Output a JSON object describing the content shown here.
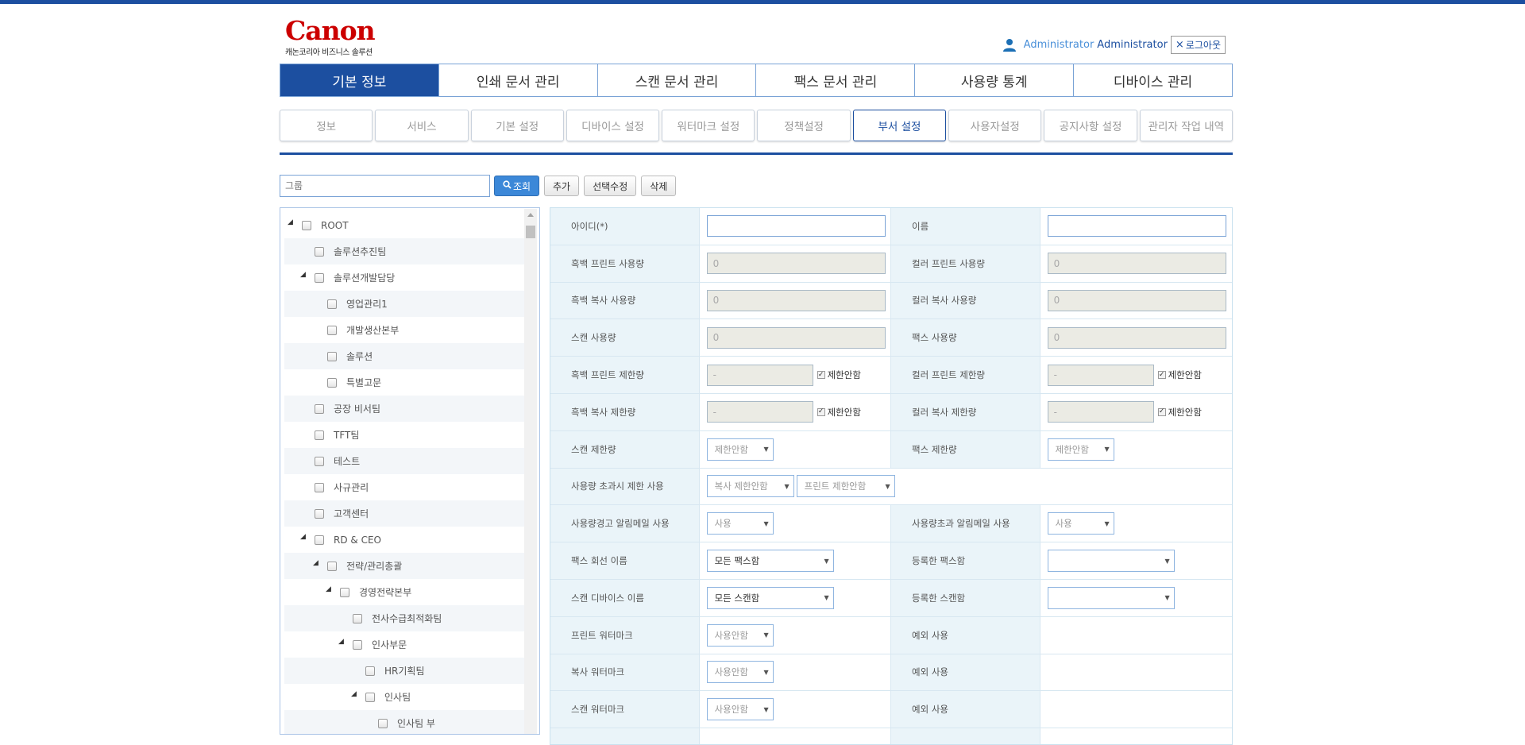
{
  "header": {
    "brand": "Canon",
    "brand_sub": "캐논코리아 비즈니스 솔루션",
    "user_role": "Administrator",
    "user_name": "Administrator",
    "logout_label": "로그아웃"
  },
  "main_nav": [
    {
      "label": "기본 정보",
      "active": true
    },
    {
      "label": "인쇄 문서 관리"
    },
    {
      "label": "스캔 문서 관리"
    },
    {
      "label": "팩스 문서 관리"
    },
    {
      "label": "사용량 통계"
    },
    {
      "label": "디바이스 관리"
    }
  ],
  "sub_nav": [
    {
      "label": "정보"
    },
    {
      "label": "서비스"
    },
    {
      "label": "기본 설정"
    },
    {
      "label": "디바이스 설정"
    },
    {
      "label": "워터마크 설정"
    },
    {
      "label": "정책설정"
    },
    {
      "label": "부서 설정",
      "active": true
    },
    {
      "label": "사용자설정"
    },
    {
      "label": "공지사항 설정"
    },
    {
      "label": "관리자 작업 내역"
    }
  ],
  "toolbar": {
    "search_placeholder": "그룹",
    "search_label": "조회",
    "add_label": "추가",
    "edit_label": "선택수정",
    "delete_label": "삭제"
  },
  "tree": [
    {
      "label": "ROOT",
      "level": 0,
      "expanded": true
    },
    {
      "label": "솔루션추진팀",
      "level": 1
    },
    {
      "label": "솔루션개발담당",
      "level": 1,
      "expanded": true
    },
    {
      "label": "영업관리1",
      "level": 2
    },
    {
      "label": "개발생산본부",
      "level": 2
    },
    {
      "label": "솔루션",
      "level": 2
    },
    {
      "label": "특별고문",
      "level": 2
    },
    {
      "label": "공장 비서팀",
      "level": 1
    },
    {
      "label": "TFT팀",
      "level": 1
    },
    {
      "label": "테스트",
      "level": 1
    },
    {
      "label": "사규관리",
      "level": 1
    },
    {
      "label": "고객센터",
      "level": 1
    },
    {
      "label": "RD & CEO",
      "level": 1,
      "expanded": true
    },
    {
      "label": "전략/관리총괄",
      "level": 2,
      "expanded": true
    },
    {
      "label": "경영전략본부",
      "level": 3,
      "expanded": true
    },
    {
      "label": "전사수급최적화팀",
      "level": 4
    },
    {
      "label": "인사부문",
      "level": 4,
      "expanded": true
    },
    {
      "label": "HR기획팀",
      "level": 5
    },
    {
      "label": "인사팀",
      "level": 5,
      "expanded": true
    },
    {
      "label": "인사팀 부",
      "level": 6
    }
  ],
  "form": {
    "id_label": "아이디(*)",
    "name_label": "이름",
    "bw_print_usage_label": "흑백 프린트 사용량",
    "bw_print_usage": "0",
    "color_print_usage_label": "컬러 프린트 사용량",
    "color_print_usage": "0",
    "bw_copy_usage_label": "흑백 복사 사용량",
    "bw_copy_usage": "0",
    "color_copy_usage_label": "컬러 복사 사용량",
    "color_copy_usage": "0",
    "scan_usage_label": "스캔 사용량",
    "scan_usage": "0",
    "fax_usage_label": "팩스 사용량",
    "fax_usage": "0",
    "bw_print_limit_label": "흑백 프린트 제한량",
    "bw_print_limit": "-",
    "color_print_limit_label": "컬러 프린트 제한량",
    "color_print_limit": "-",
    "bw_copy_limit_label": "흑백 복사 제한량",
    "bw_copy_limit": "-",
    "color_copy_limit_label": "컬러 복사 제한량",
    "color_copy_limit": "-",
    "no_limit_label": "제한안함",
    "scan_limit_label": "스캔 제한량",
    "scan_limit_value": "제한안함",
    "fax_limit_label": "팩스 제한량",
    "fax_limit_value": "제한안함",
    "over_limit_label": "사용량 초과시 제한 사용",
    "copy_no_limit": "복사 제한안함",
    "print_no_limit": "프린트 제한안함",
    "warn_mail_label": "사용량경고 알림메일 사용",
    "warn_mail_value": "사용",
    "over_mail_label": "사용량초과 알림메일 사용",
    "over_mail_value": "사용",
    "fax_line_label": "팩스 회선 이름",
    "fax_line_value": "모든 팩스함",
    "reg_fax_label": "등록한 팩스함",
    "reg_fax_value": "",
    "scan_device_label": "스캔 디바이스 이름",
    "scan_device_value": "모든 스캔함",
    "reg_scan_label": "등록한 스캔함",
    "reg_scan_value": "",
    "print_wm_label": "프린트 워터마크",
    "print_wm_value": "사용안함",
    "exception_label": "예외 사용",
    "copy_wm_label": "복사 워터마크",
    "copy_wm_value": "사용안함",
    "scan_wm_label": "스캔 워터마크",
    "scan_wm_value": "사용안함"
  },
  "colors": {
    "primary": "#1c4fa0",
    "search_button": "#3c88d8",
    "label_bg": "#eaf4f9"
  }
}
